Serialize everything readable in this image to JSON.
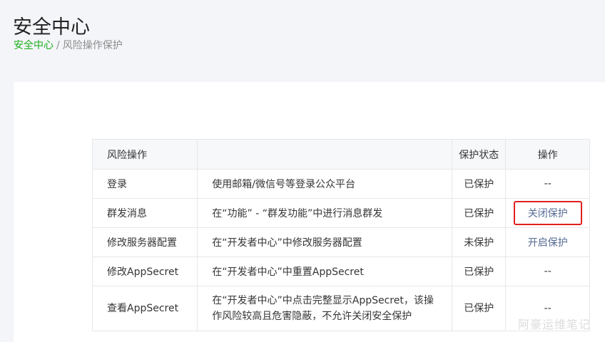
{
  "header": {
    "title": "安全中心"
  },
  "breadcrumb": {
    "root": "安全中心",
    "separator": "/",
    "current": "风险操作保护"
  },
  "table": {
    "columns": [
      "风险操作",
      "",
      "保护状态",
      "操作"
    ],
    "rows": [
      {
        "operation": "登录",
        "description": "使用邮箱/微信号等登录公众平台",
        "status": "已保护",
        "action": "--"
      },
      {
        "operation": "群发消息",
        "description": "在“功能” - “群发功能”中进行消息群发",
        "status": "已保护",
        "action": "关闭保护"
      },
      {
        "operation": "修改服务器配置",
        "description": "在“开发者中心”中修改服务器配置",
        "status": "未保护",
        "action": "开启保护"
      },
      {
        "operation": "修改AppSecret",
        "description": "在“开发者中心”中重置AppSecret",
        "status": "已保护",
        "action": "--"
      },
      {
        "operation": "查看AppSecret",
        "description": "在“开发者中心”中点击完整显示AppSecret，该操作风险较高且危害隐蔽，不允许关闭安全保护",
        "status": "已保护",
        "action": "--"
      }
    ]
  },
  "watermark": "阿豪运维笔记",
  "colors": {
    "brand_green": "#1aad19",
    "link_blue": "#576b95",
    "highlight_red": "#e02020",
    "background": "#f4f5f9"
  }
}
